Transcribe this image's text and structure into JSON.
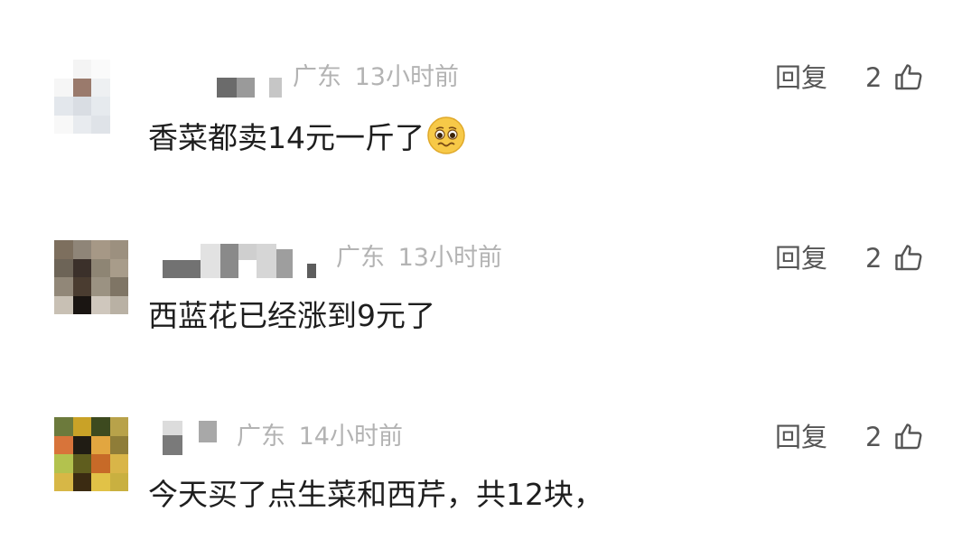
{
  "comments": [
    {
      "location": "广东",
      "time": "13小时前",
      "reply_label": "回复",
      "likes": "2",
      "text": "香菜都卖14元一斤了",
      "emoji": "woozy-pleading-emoji"
    },
    {
      "location": "广东",
      "time": "13小时前",
      "reply_label": "回复",
      "likes": "2",
      "text": "西蓝花已经涨到9元了"
    },
    {
      "location": "广东",
      "time": "14小时前",
      "reply_label": "回复",
      "likes": "2",
      "text": "今天买了点生菜和西芹，共12块，"
    }
  ],
  "icons": {
    "like": "thumbs-up-icon",
    "avatar": "pixelated-avatar"
  },
  "colors": {
    "meta": "#b3b3b3",
    "text": "#1e1e1e",
    "action": "#555555"
  }
}
